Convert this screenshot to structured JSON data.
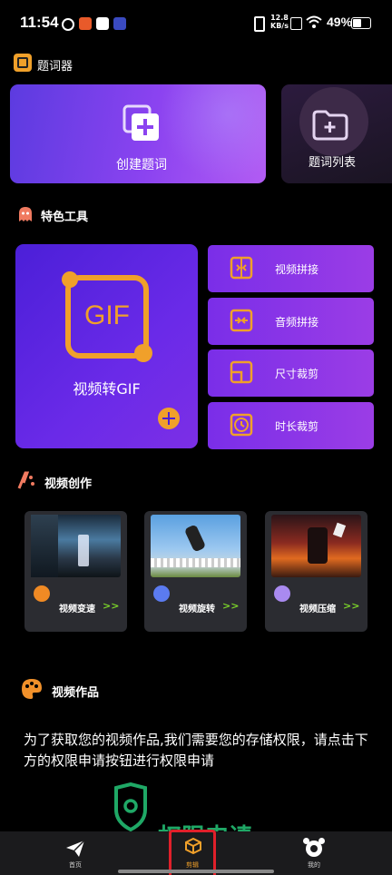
{
  "status_bar": {
    "time": "11:54",
    "net_speed_value": "12.8",
    "net_speed_unit": "KB/s",
    "battery": "49%"
  },
  "teleprompter": {
    "section_title": "题词器",
    "create_label": "创建题词",
    "list_label": "题词列表"
  },
  "tools": {
    "section_title": "特色工具",
    "gif_text": "GIF",
    "gif_label": "视频转GIF",
    "buttons": [
      "视频拼接",
      "音频拼接",
      "尺寸裁剪",
      "时长裁剪"
    ]
  },
  "creation": {
    "section_title": "视频创作",
    "cards": [
      {
        "label": "视频变速",
        "arrow": ">>",
        "dot_color": "#f08a24"
      },
      {
        "label": "视频旋转",
        "arrow": ">>",
        "dot_color": "#5b7bf0"
      },
      {
        "label": "视频压缩",
        "arrow": ">>",
        "dot_color": "#a98af0"
      }
    ]
  },
  "works": {
    "section_title": "视频作品",
    "permission_text": "为了获取您的视频作品,我们需要您的存储权限，请点击下方的权限申请按钮进行权限申请",
    "permission_button": "权限申请"
  },
  "nav": {
    "home": "首页",
    "clip": "剪辑",
    "mine": "我的"
  },
  "colors": {
    "accent_orange": "#f0a02a",
    "accent_purple": "#8b3fe8",
    "highlight_red": "#e0202a",
    "green": "#22aa66"
  }
}
